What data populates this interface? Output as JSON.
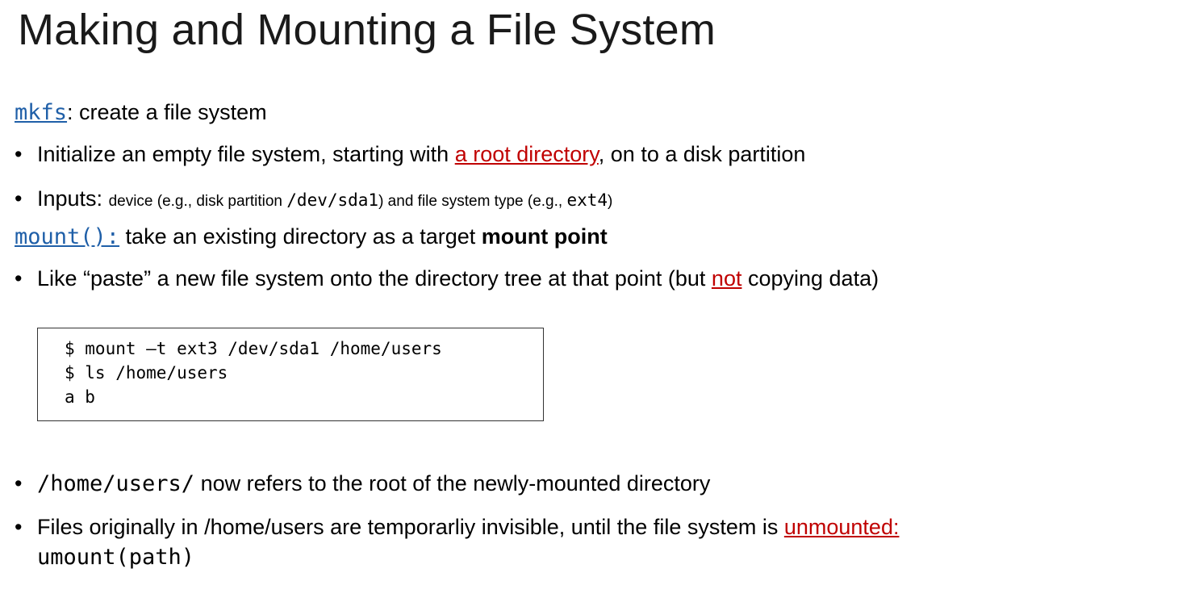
{
  "slide": {
    "title": "Making and Mounting a File System",
    "mkfs": {
      "cmd": "mkfs",
      "desc": ": create a file system",
      "bullet1": {
        "pre": "Initialize an empty file system, starting with ",
        "link": "a root directory",
        "post": ", on to a disk partition"
      },
      "bullet2": {
        "label": "Inputs: ",
        "t1": "device (e.g., disk partition ",
        "c1": "/dev/sda1",
        "t2": ") and file system type (e.g., ",
        "c2": "ext4",
        "t3": ")"
      }
    },
    "mount": {
      "cmd": "mount():",
      "desc": " take an existing directory as a target ",
      "bold": "mount point",
      "bullet1": {
        "pre": "Like “paste” a new file system onto the directory tree at that point (but ",
        "link": "not",
        "post": " copying data)"
      }
    },
    "code": [
      "$ mount –t ext3 /dev/sda1 /home/users",
      "$ ls /home/users",
      "a b"
    ],
    "after": {
      "bullet1": {
        "code": "/home/users/",
        "text": " now refers to the root of the newly-mounted directory"
      },
      "bullet2": {
        "pre": "Files originally in /home/users are temporarliy invisible, until the file system is ",
        "link": "unmounted:",
        "code": "umount(path)"
      }
    },
    "bullet_char": "•",
    "colors": {
      "link_blue": "#1f5fa8",
      "link_red": "#c00000"
    }
  }
}
